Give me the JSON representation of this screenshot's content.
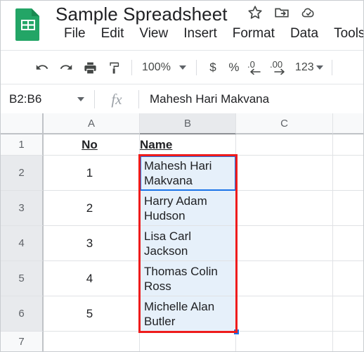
{
  "header": {
    "logo_icon": "google-sheets-logo",
    "doc_title": "Sample Spreadsheet",
    "title_icons": [
      {
        "name": "star-icon",
        "label": "Star"
      },
      {
        "name": "move-to-folder-icon",
        "label": "Move"
      },
      {
        "name": "cloud-saved-icon",
        "label": "Saved to Drive"
      }
    ]
  },
  "menubar": {
    "items": [
      {
        "label": "File"
      },
      {
        "label": "Edit"
      },
      {
        "label": "View"
      },
      {
        "label": "Insert"
      },
      {
        "label": "Format"
      },
      {
        "label": "Data"
      },
      {
        "label": "Tools"
      }
    ]
  },
  "toolbar": {
    "undo_icon": "undo-icon",
    "redo_icon": "redo-icon",
    "print_icon": "print-icon",
    "paint_format_icon": "paint-format-icon",
    "zoom_value": "100%",
    "currency_label": "$",
    "percent_label": "%",
    "decrease_decimal_icon": "decrease-decimal-icon",
    "increase_decimal_icon": "increase-decimal-icon",
    "number_format_label": "123"
  },
  "formula_bar": {
    "name_box_value": "B2:B6",
    "fx_label": "fx",
    "formula_value": "Mahesh Hari Makvana"
  },
  "grid": {
    "columns": [
      {
        "label": "A",
        "selected": false
      },
      {
        "label": "B",
        "selected": true
      },
      {
        "label": "C",
        "selected": false
      },
      {
        "label": "",
        "selected": false
      }
    ],
    "rows": [
      {
        "label": "1",
        "selected": false
      },
      {
        "label": "2",
        "selected": true
      },
      {
        "label": "3",
        "selected": true
      },
      {
        "label": "4",
        "selected": true
      },
      {
        "label": "5",
        "selected": true
      },
      {
        "label": "6",
        "selected": true
      },
      {
        "label": "7",
        "selected": false
      }
    ],
    "cells": {
      "A1": "No",
      "B1": "Name",
      "A2": "1",
      "A3": "2",
      "A4": "3",
      "A5": "4",
      "A6": "5",
      "B2": "Mahesh Hari Makvana",
      "B3": "Harry Adam Hudson",
      "B4": "Lisa Carl Jackson",
      "B5": "Thomas Colin Ross",
      "B6": "Michelle Alan Butler"
    },
    "selection": {
      "range": "B2:B6",
      "active_cell": "B2",
      "fill_handle": true
    }
  },
  "annotation": {
    "type": "red-highlight-box",
    "target_range": "B2:B6"
  },
  "colors": {
    "accent": "#1a73e8",
    "annotation": "#ee1c1c",
    "selection_fill": "#e6f0fa",
    "header_selected": "#e8eaed",
    "logo_green": "#23a566"
  }
}
